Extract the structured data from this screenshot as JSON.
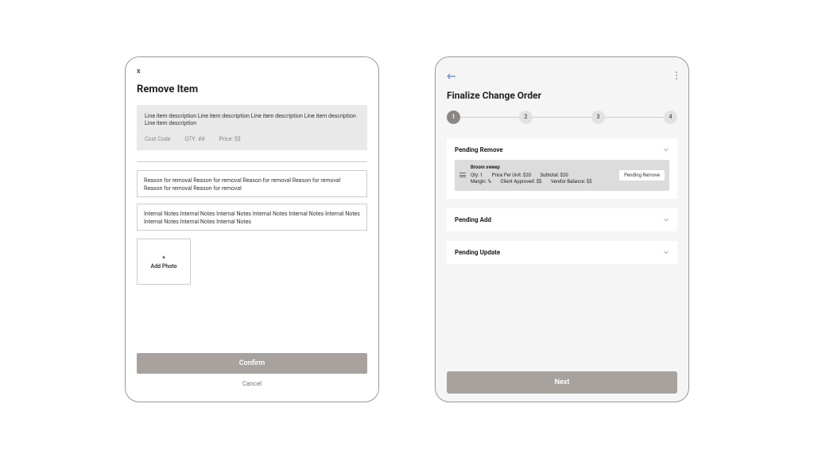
{
  "left": {
    "close": "x",
    "title": "Remove Item",
    "item": {
      "description": "Line item description Line item description Line item description Line item description Line item description",
      "cost_code": "Cost Code",
      "qty": "QTY: ##",
      "price": "Price: $$"
    },
    "reason": "Reason for removal Reason for removal Reason for removal Reason for removal Reason for removal Reason for removal",
    "notes": "Internal Notes Internal Notes Internal Notes Internal Notes Internal Notes Internal Notes Internal Notes Internal Notes Internal Notes",
    "add_photo_plus": "+",
    "add_photo": "Add Photo",
    "confirm": "Confirm",
    "cancel": "Cancel"
  },
  "right": {
    "title": "Finalize Change Order",
    "steps": [
      "1",
      "2",
      "3",
      "4"
    ],
    "sections": {
      "pending_remove": "Pending Remove",
      "pending_add": "Pending Add",
      "pending_update": "Pending Update"
    },
    "line_item": {
      "name": "Broom sweep",
      "row1": {
        "qty": "Qty: 1",
        "ppu": "Price Per Unit: $20",
        "subtotal": "Subtotal: $20"
      },
      "row2": {
        "margin": "Margin: %",
        "client": "Client Approved: $$",
        "vendor": "Vendor Balance: $$"
      },
      "status": "Pending Remove"
    },
    "next": "Next"
  }
}
